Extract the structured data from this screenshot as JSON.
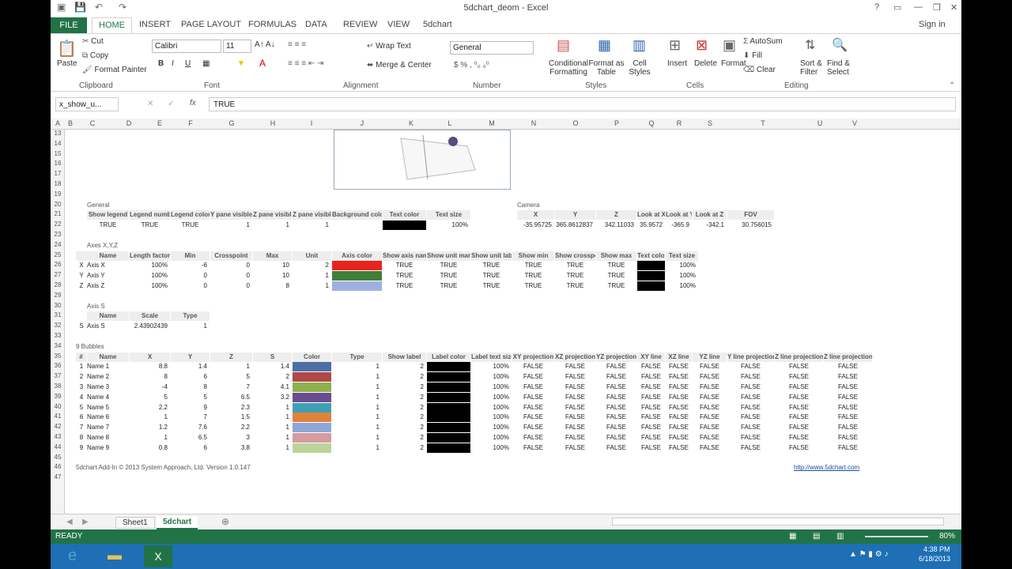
{
  "window": {
    "title": "5dchart_deom - Excel",
    "signin": "Sign in"
  },
  "ribbon": {
    "tabs": [
      "FILE",
      "HOME",
      "INSERT",
      "PAGE LAYOUT",
      "FORMULAS",
      "DATA",
      "REVIEW",
      "VIEW",
      "5dchart"
    ],
    "clipboard": {
      "cut": "Cut",
      "copy": "Copy",
      "paste": "Paste",
      "format_painter": "Format Painter",
      "label": "Clipboard"
    },
    "font": {
      "name": "Calibri",
      "size": "11",
      "label": "Font"
    },
    "alignment": {
      "wrap": "Wrap Text",
      "merge": "Merge & Center",
      "label": "Alignment"
    },
    "number": {
      "format": "General",
      "label": "Number"
    },
    "styles": {
      "conditional": "Conditional Formatting",
      "format_table": "Format as Table",
      "cell_styles": "Cell Styles",
      "label": "Styles"
    },
    "cells": {
      "insert": "Insert",
      "delete": "Delete",
      "format": "Format",
      "label": "Cells"
    },
    "editing": {
      "autosum": "AutoSum",
      "fill": "Fill",
      "clear": "Clear",
      "sort": "Sort & Filter",
      "find": "Find & Select",
      "label": "Editing"
    }
  },
  "formula": {
    "name_box": "x_show_u...",
    "content": "TRUE"
  },
  "columns": [
    "A",
    "B",
    "C",
    "D",
    "E",
    "F",
    "G",
    "H",
    "I",
    "J",
    "K",
    "L",
    "M",
    "N",
    "O",
    "P",
    "Q",
    "R",
    "S",
    "T",
    "U",
    "V"
  ],
  "rows": [
    "13",
    "14",
    "15",
    "16",
    "17",
    "18",
    "19",
    "20",
    "21",
    "22",
    "23",
    "24",
    "25",
    "26",
    "27",
    "28",
    "29",
    "30",
    "31",
    "32",
    "33",
    "34",
    "35",
    "36",
    "37",
    "38",
    "39",
    "40",
    "41",
    "42",
    "43",
    "44",
    "45",
    "46",
    "47"
  ],
  "general": {
    "title": "General",
    "headers": [
      "Show legend",
      "Legend number",
      "Legend color",
      "Y pane visible",
      "Z pane visible",
      "Z pane visible",
      "Background color",
      "Text color",
      "Text size"
    ],
    "values": [
      "TRUE",
      "TRUE",
      "TRUE",
      "1",
      "1",
      "1",
      "",
      "",
      "100%"
    ]
  },
  "camera": {
    "title": "Camera",
    "headers": [
      "X",
      "Y",
      "Z",
      "Look at X",
      "Look at Y",
      "Look at Z",
      "FOV"
    ],
    "values": [
      "-35.95725",
      "365.8612837",
      "342.11033",
      "35.9572",
      "-365.9",
      "-342.1",
      "30.756015"
    ]
  },
  "axes": {
    "title": "Axes X,Y,Z",
    "headers": [
      "Name",
      "Length factor",
      "Min",
      "Crosspoint",
      "Max",
      "Unit",
      "Axis color",
      "Show axis name",
      "Show unit mark",
      "Show unit label",
      "Show min",
      "Show crosspoint",
      "Show max",
      "Text color",
      "Text size"
    ],
    "rows": [
      {
        "key": "X",
        "name": "Axis X",
        "len": "100%",
        "min": "-6",
        "cross": "0",
        "max": "10",
        "unit": "2",
        "color": "#e8231f",
        "b": [
          "TRUE",
          "TRUE",
          "TRUE",
          "TRUE",
          "TRUE",
          "TRUE"
        ],
        "size": "100%"
      },
      {
        "key": "Y",
        "name": "Axis Y",
        "len": "100%",
        "min": "0",
        "cross": "0",
        "max": "10",
        "unit": "1",
        "color": "#3f7f3a",
        "b": [
          "TRUE",
          "TRUE",
          "TRUE",
          "TRUE",
          "TRUE",
          "TRUE"
        ],
        "size": "100%"
      },
      {
        "key": "Z",
        "name": "Axis Z",
        "len": "100%",
        "min": "0",
        "cross": "0",
        "max": "8",
        "unit": "1",
        "color": "#9fb0e0",
        "b": [
          "TRUE",
          "TRUE",
          "TRUE",
          "TRUE",
          "TRUE",
          "TRUE"
        ],
        "size": "100%"
      }
    ]
  },
  "axis_s": {
    "title": "Axis S",
    "headers": [
      "Name",
      "Scale",
      "Type"
    ],
    "key": "S",
    "name": "Axis S",
    "scale": "2.43902439",
    "type": "1"
  },
  "bubbles": {
    "title": "9 Bubbles",
    "headers": [
      "#",
      "Name",
      "X",
      "Y",
      "Z",
      "S",
      "Color",
      "Type",
      "Show label",
      "Label color",
      "Label text size",
      "XY projection",
      "XZ projection",
      "YZ projection",
      "XY line",
      "XZ line",
      "YZ line",
      "Y line projection",
      "Z line projection",
      "Z line projection"
    ],
    "rows": [
      {
        "n": "1",
        "name": "Name 1",
        "x": "8.8",
        "y": "1.4",
        "z": "1",
        "s": "1.4",
        "color": "#4d6fa3"
      },
      {
        "n": "2",
        "name": "Name 2",
        "x": "8",
        "y": "6",
        "z": "5",
        "s": "2",
        "color": "#b04848"
      },
      {
        "n": "3",
        "name": "Name 3",
        "x": "-4",
        "y": "8",
        "z": "7",
        "s": "4.1",
        "color": "#8fb04d"
      },
      {
        "n": "4",
        "name": "Name 4",
        "x": "5",
        "y": "5",
        "z": "6.5",
        "s": "3.2",
        "color": "#6a4c8f"
      },
      {
        "n": "5",
        "name": "Name 5",
        "x": "2.2",
        "y": "9",
        "z": "2.3",
        "s": "1",
        "color": "#3fa0b3"
      },
      {
        "n": "6",
        "name": "Name 6",
        "x": "1",
        "y": "7",
        "z": "1.5",
        "s": "1",
        "color": "#e0833a"
      },
      {
        "n": "7",
        "name": "Name 7",
        "x": "1.2",
        "y": "7.6",
        "z": "2.2",
        "s": "1",
        "color": "#8ea7d8"
      },
      {
        "n": "8",
        "name": "Name 8",
        "x": "1",
        "y": "6.5",
        "z": "3",
        "s": "1",
        "color": "#d69ba0"
      },
      {
        "n": "9",
        "name": "Name 9",
        "x": "0.8",
        "y": "6",
        "z": "3.8",
        "s": "1",
        "color": "#bcd49a"
      }
    ],
    "type": "1",
    "show_label": "2",
    "size": "100%",
    "flag": "FALSE"
  },
  "footer": {
    "note": "5dchart Add-In © 2013 System Approach, Ltd. Version 1.0.147",
    "link": "http://www.5dchart.com"
  },
  "sheets": [
    "Sheet1",
    "5dchart"
  ],
  "status": {
    "ready": "READY",
    "zoom": "80%"
  },
  "clock": {
    "time": "4:38 PM",
    "date": "6/18/2013"
  }
}
